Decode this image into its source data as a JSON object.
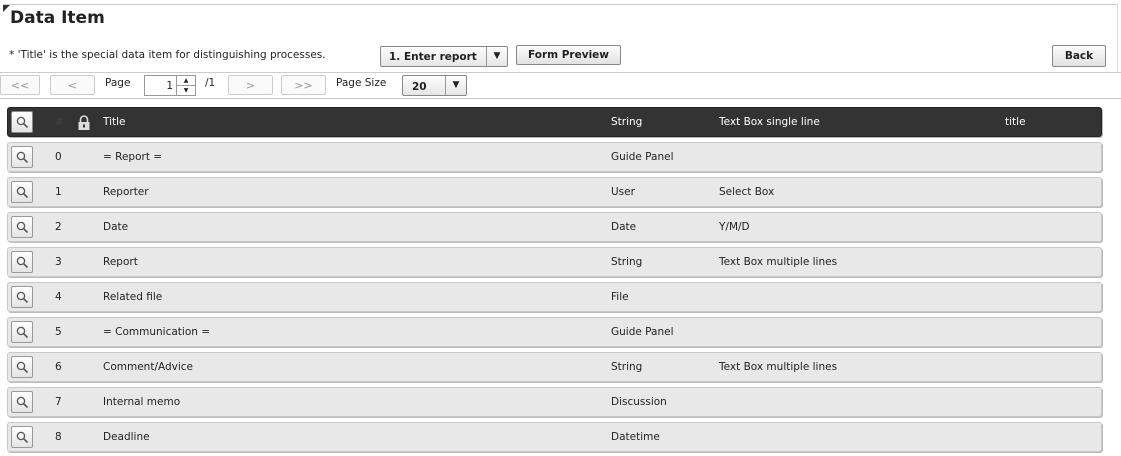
{
  "page": {
    "title": "Data Item",
    "note": "* 'Title' is the special data item for distinguishing processes."
  },
  "toolbar": {
    "form_select_value": "1. Enter report",
    "form_preview_label": "Form Preview",
    "back_label": "Back"
  },
  "pager": {
    "first_label": "<<",
    "prev_label": "<",
    "page_label": "Page",
    "page_value": "1",
    "total_label": "/1",
    "next_label": ">",
    "last_label": ">>",
    "page_size_label": "Page Size",
    "page_size_value": "20"
  },
  "table": {
    "header": {
      "number": "#",
      "title": "Title",
      "type": "String",
      "input": "Text Box single line",
      "key": "title"
    },
    "rows": [
      {
        "number": "0",
        "title": "= Report =",
        "type": "Guide Panel",
        "input": ""
      },
      {
        "number": "1",
        "title": "Reporter",
        "type": "User",
        "input": "Select Box"
      },
      {
        "number": "2",
        "title": "Date",
        "type": "Date",
        "input": "Y/M/D"
      },
      {
        "number": "3",
        "title": "Report",
        "type": "String",
        "input": "Text Box multiple lines"
      },
      {
        "number": "4",
        "title": "Related file",
        "type": "File",
        "input": ""
      },
      {
        "number": "5",
        "title": "= Communication =",
        "type": "Guide Panel",
        "input": ""
      },
      {
        "number": "6",
        "title": "Comment/Advice",
        "type": "String",
        "input": "Text Box multiple lines"
      },
      {
        "number": "7",
        "title": "Internal memo",
        "type": "Discussion",
        "input": ""
      },
      {
        "number": "8",
        "title": "Deadline",
        "type": "Datetime",
        "input": ""
      }
    ]
  },
  "icons": {
    "view": "magnifier-icon",
    "lock": "lock-icon"
  }
}
